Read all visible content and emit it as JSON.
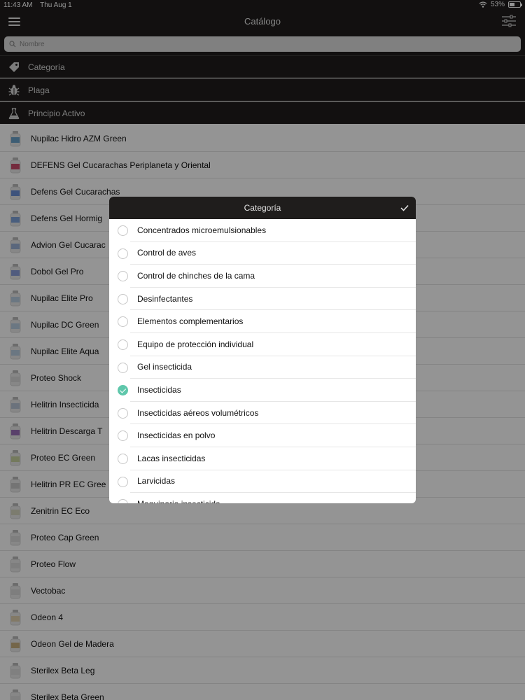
{
  "status_bar": {
    "time": "11:43 AM",
    "date": "Thu Aug 1",
    "battery": "53%",
    "battery_level": 0.53
  },
  "nav": {
    "title": "Catálogo",
    "menu_icon": "hamburger-icon",
    "filter_icon": "sliders-icon"
  },
  "search": {
    "placeholder": "Nombre"
  },
  "filters": [
    {
      "label": "Categoría",
      "icon": "tag-icon"
    },
    {
      "label": "Plaga",
      "icon": "bug-icon"
    },
    {
      "label": "Principio Activo",
      "icon": "flask-icon"
    }
  ],
  "products": [
    "Nupilac Hidro AZM Green",
    "DEFENS Gel Cucarachas Periplaneta y Oriental",
    "Defens Gel Cucarachas",
    "Defens Gel Hormig",
    "Advion Gel Cucarac",
    "Dobol Gel Pro",
    "Nupilac Elite Pro",
    "Nupilac DC Green",
    "Nupilac Elite Aqua",
    "Proteo Shock",
    "Helitrin Insecticida",
    "Helitrin Descarga T",
    "Proteo EC Green",
    "Helitrin PR EC Gree",
    "Zenitrin EC Eco",
    "Proteo Cap Green",
    "Proteo Flow",
    "Vectobac",
    "Odeon 4",
    "Odeon Gel de Madera",
    "Sterilex Beta Leg",
    "Sterilex Beta Green"
  ],
  "modal": {
    "title": "Categoría",
    "confirm_icon": "checkmark-icon",
    "options": [
      {
        "label": "Concentrados microemulsionables",
        "selected": false
      },
      {
        "label": "Control de aves",
        "selected": false
      },
      {
        "label": "Control de chinches de la cama",
        "selected": false
      },
      {
        "label": "Desinfectantes",
        "selected": false
      },
      {
        "label": "Elementos complementarios",
        "selected": false
      },
      {
        "label": "Equipo de protección individual",
        "selected": false
      },
      {
        "label": "Gel insecticida",
        "selected": false
      },
      {
        "label": "Insecticidas",
        "selected": true
      },
      {
        "label": "Insecticidas aéreos volumétricos",
        "selected": false
      },
      {
        "label": "Insecticidas en polvo",
        "selected": false
      },
      {
        "label": "Lacas insecticidas",
        "selected": false
      },
      {
        "label": "Larvicidas",
        "selected": false
      },
      {
        "label": "Maquinaria insecticida",
        "selected": false
      }
    ]
  },
  "colors": {
    "dark": "#1f1d1c",
    "accent": "#5fc7ab"
  }
}
